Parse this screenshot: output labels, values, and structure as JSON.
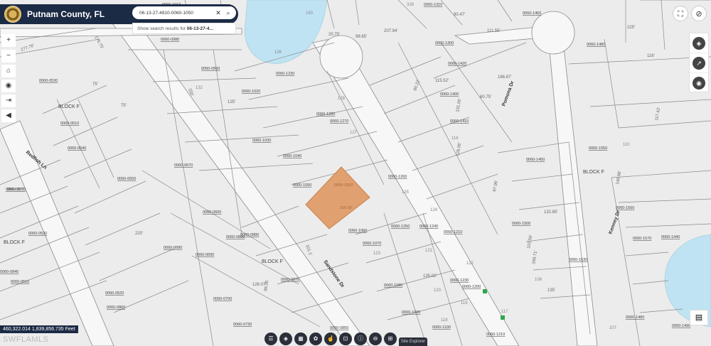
{
  "app": {
    "title": "Putnam County, FL",
    "logo_icon": "county-seal-icon"
  },
  "search": {
    "value": "06-13-27-4910-0060-1050",
    "clear_icon": "✕",
    "search_icon": "⌕",
    "suggestion_prefix": "Show search results for",
    "suggestion_term": "06-13-27-4..."
  },
  "left_controls": [
    "+",
    "−",
    "⌂",
    "◉",
    "⇥",
    "◀"
  ],
  "coordinates": "460,322.014 1,839,856.735 Feet",
  "watermark": "SWFLAMLS",
  "colors": {
    "header": "#1b2a45",
    "selected_parcel": "#e0a070",
    "water": "#bfe3f2",
    "parcel_line": "#8a8a8a",
    "road": "#f6f6f6"
  },
  "toolbar": {
    "buttons": [
      "☰",
      "◈",
      "▦",
      "✿",
      "☝",
      "⊡",
      "ⓘ",
      "⊖",
      "⊞"
    ],
    "tab_label": "Site Explorer"
  },
  "map": {
    "streets": [
      "Redfish Ln",
      "Sandstone Dr",
      "Pomona Dr",
      "Kenney Dr"
    ],
    "blocks": [
      "BLOCK F",
      "BLOCK F",
      "BLOCK F",
      "BLOCK F"
    ],
    "parcel_ids": [
      "0060-1010",
      "0060-0980",
      "0060-0990",
      "0060-1230",
      "0060-1020",
      "0060-0530",
      "0060-0610",
      "0060-0640",
      "0060-0570",
      "0060-0520",
      "0060-0650",
      "0060-0670",
      "0060-0600",
      "0060-0890",
      "0060-0880",
      "0060-0680",
      "0060-0690",
      "0060-0700",
      "0060-0870",
      "0060-0730",
      "0060-0840",
      "0060-0510",
      "0060-0520",
      "0060-0860",
      "0060-0850",
      "0060-1280",
      "0060-1270",
      "0060-1030",
      "0060-1040",
      "0060-1050",
      "0060-1260",
      "0060-1250",
      "0060-1060",
      "0060-1070",
      "0060-1080",
      "0060-1240",
      "0060-1210",
      "0060-1230",
      "0060-1090",
      "0060-1100",
      "0060-1310",
      "0060-1300",
      "0060-1420",
      "0060-1400",
      "0060-1410",
      "0060-1460",
      "0060-1480",
      "0060-1450",
      "0060-1500",
      "0060-1530",
      "0060-1550",
      "0060-1560",
      "0060-1570",
      "0060-1480",
      "0060-1490",
      "0060-1440",
      "0060-1200",
      "0060-1210",
      "0060-0570"
    ],
    "dims": [
      "135'",
      "135'",
      "75'",
      "75'",
      "150'",
      "125'",
      "220'",
      "277.76'",
      "176.75'",
      "20.75'",
      "98.65'",
      "207.94'",
      "111.55'",
      "80.22'",
      "115.52'",
      "60.75'",
      "131.05'",
      "186.67'",
      "128.06'",
      "97.96'",
      "102.59'",
      "168.71'",
      "132.85'",
      "146.98'",
      "117.42'",
      "116'",
      "225'",
      "101.1'",
      "86.05'",
      "126.07'",
      "135.02'",
      "135'",
      "90.47'"
    ],
    "lot_numbers": [
      "128",
      "132",
      "116",
      "110",
      "326",
      "126",
      "127",
      "124",
      "125",
      "123",
      "121",
      "122",
      "120",
      "119",
      "118",
      "117",
      "108",
      "107",
      "150"
    ],
    "selected_lot_labels": [
      "0060-1050",
      "106 SF"
    ]
  }
}
